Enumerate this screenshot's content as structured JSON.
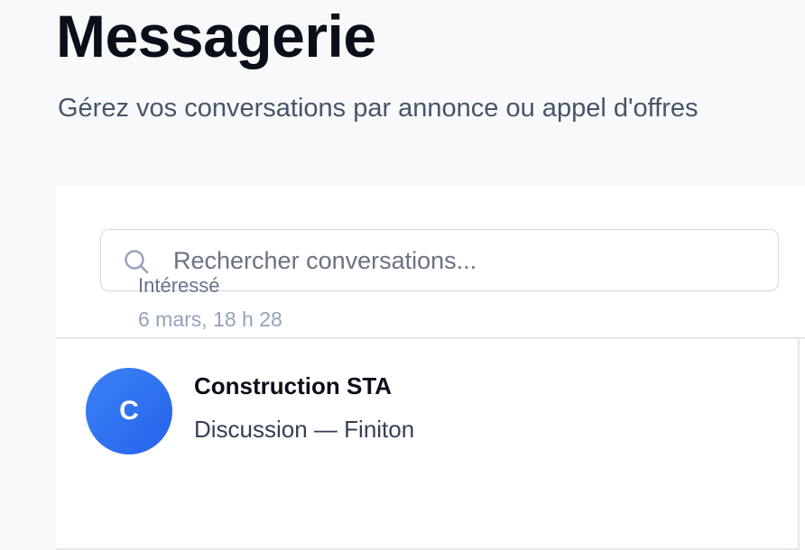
{
  "header": {
    "title": "Messagerie",
    "subtitle": "Gérez vos conversations par annonce ou appel d'offres"
  },
  "search": {
    "placeholder": "Rechercher conversations...",
    "value": "",
    "icon": "search-icon"
  },
  "conversations": [
    {
      "avatar_initial": "C",
      "name": "Construction STA",
      "subject": "Discussion — Finiton",
      "status": "Intéressé",
      "timestamp": "6 mars, 18 h 28"
    }
  ],
  "colors": {
    "background": "#f8f9fb",
    "panel": "#ffffff",
    "avatar": "#2563eb",
    "title": "#0b0f19",
    "subtitle": "#475569",
    "status": "#64748b",
    "timestamp": "#94a3b8"
  }
}
